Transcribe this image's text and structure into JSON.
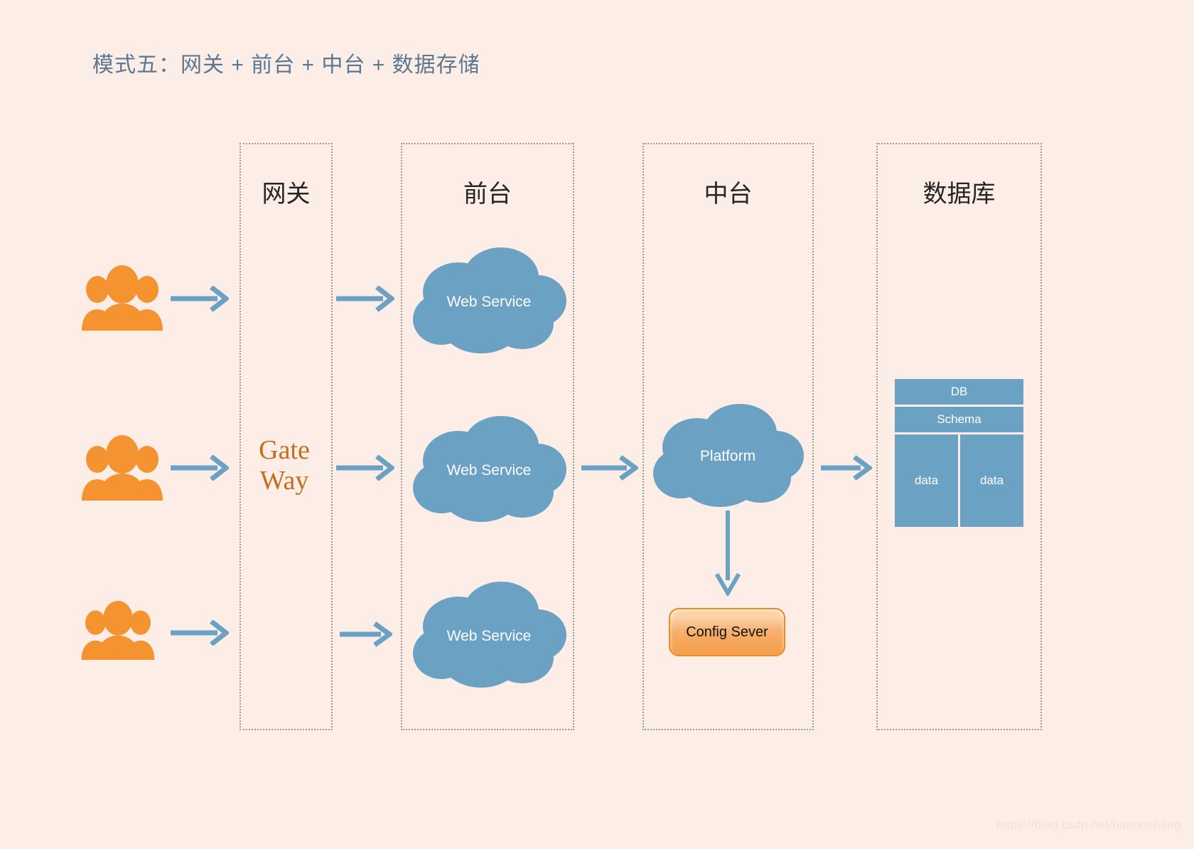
{
  "title": "模式五：网关 + 前台 + 中台 + 数据存储",
  "colors": {
    "background": "#fceee6",
    "title_text": "#5b7893",
    "lane_border": "#9b9b93",
    "arrow": "#6ba2c4",
    "cloud": "#6ba2c4",
    "people_icon": "#f59331",
    "gateway_text": "#c1701d",
    "config_border": "#ec8922",
    "db_cell": "#6ba2c4",
    "lane_title_text": "#252525"
  },
  "lanes": [
    {
      "id": "gateway",
      "title": "网关"
    },
    {
      "id": "frontend",
      "title": "前台"
    },
    {
      "id": "middle",
      "title": "中台"
    },
    {
      "id": "database",
      "title": "数据库"
    }
  ],
  "gateway": {
    "line1": "Gate",
    "line2": "Way"
  },
  "users": [
    {
      "id": "user-group-1",
      "label": "users"
    },
    {
      "id": "user-group-2",
      "label": "users"
    },
    {
      "id": "user-group-3",
      "label": "users"
    }
  ],
  "frontend": {
    "services": [
      {
        "label": "Web Service"
      },
      {
        "label": "Web Service"
      },
      {
        "label": "Web Service"
      }
    ]
  },
  "middle": {
    "platform_label": "Platform",
    "config_server_label": "Config Sever"
  },
  "database": {
    "header": "DB",
    "schema": "Schema",
    "cells": [
      "data",
      "data"
    ]
  },
  "watermark": "https://blog.csdn.net/haponchang"
}
